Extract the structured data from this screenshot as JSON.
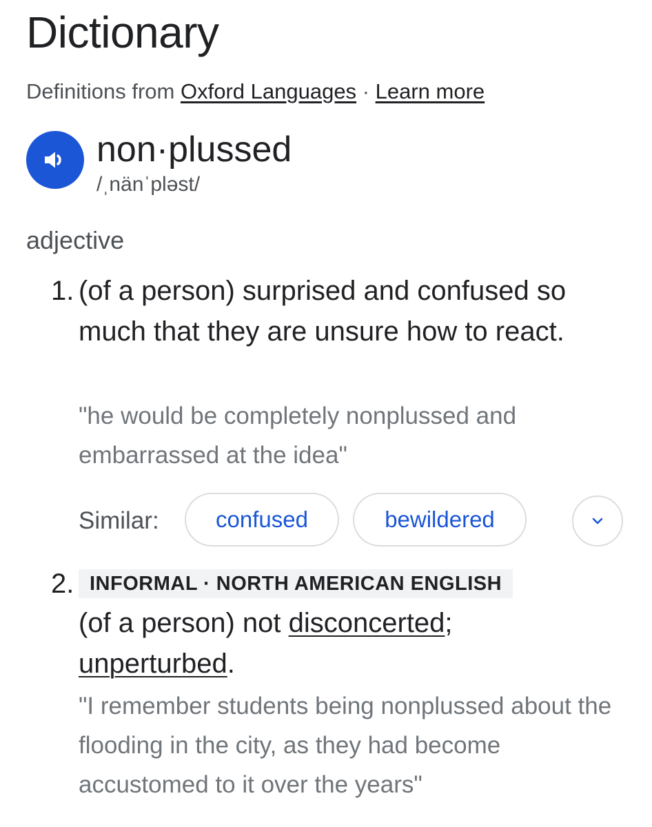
{
  "header": {
    "title": "Dictionary",
    "source_prefix": "Definitions from",
    "source_link": "Oxford Languages",
    "separator": "·",
    "learn_more": "Learn more"
  },
  "entry": {
    "audio_icon": "speaker-icon",
    "word": "non·plussed",
    "phonetic": "/ˌnänˈpləst/",
    "part_of_speech": "adjective"
  },
  "definitions": [
    {
      "number": "1.",
      "text": "(of a person) surprised and confused so much that they are unsure how to react.",
      "example": "\"he would be completely nonplussed and embarrassed at the idea\"",
      "similar_label": "Similar:",
      "similar": [
        "confused",
        "bewildered"
      ],
      "expand_icon": "chevron-down-icon"
    },
    {
      "number": "2.",
      "labels": "INFORMAL · NORTH AMERICAN ENGLISH",
      "text_prefix": "(of a person) not",
      "link1": "disconcerted",
      "mid": ";",
      "link2": "unperturbed",
      "suffix": ".",
      "example": "\"I remember students being nonplussed about the flooding in the city, as they had become accustomed to it over the years\""
    }
  ],
  "colors": {
    "accent": "#1a56d6",
    "text": "#202124",
    "secondary_text": "#4d5156",
    "example_text": "#70757a",
    "chip_border": "#dadce0",
    "label_bg": "#f1f3f4"
  }
}
